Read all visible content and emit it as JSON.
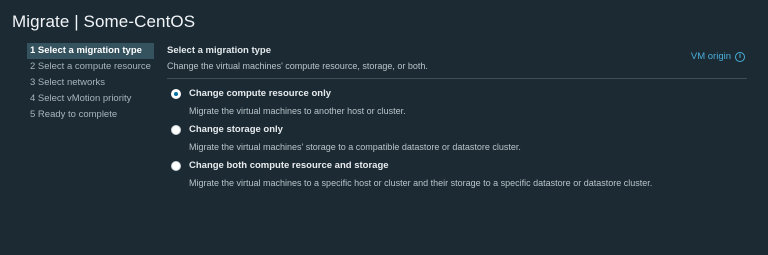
{
  "dialog": {
    "title": "Migrate | Some-CentOS"
  },
  "steps": [
    {
      "label": "1 Select a migration type",
      "active": true
    },
    {
      "label": "2 Select a compute resource",
      "active": false
    },
    {
      "label": "3 Select networks",
      "active": false
    },
    {
      "label": "4 Select vMotion priority",
      "active": false
    },
    {
      "label": "5 Ready to complete",
      "active": false
    }
  ],
  "main": {
    "section_title": "Select a migration type",
    "section_desc": "Change the virtual machines' compute resource, storage, or both.",
    "vm_origin_label": "VM origin",
    "info_icon": "info-icon",
    "options": [
      {
        "label": "Change compute resource only",
        "desc": "Migrate the virtual machines to another host or cluster.",
        "selected": true
      },
      {
        "label": "Change storage only",
        "desc": "Migrate the virtual machines' storage to a compatible datastore or datastore cluster.",
        "selected": false
      },
      {
        "label": "Change both compute resource and storage",
        "desc": "Migrate the virtual machines to a specific host or cluster and their storage to a specific datastore or datastore cluster.",
        "selected": false
      }
    ]
  },
  "colors": {
    "background": "#1b2a33",
    "active_step_bg": "#35525f",
    "link": "#4aaed9",
    "radio_selected": "#0072a3"
  }
}
